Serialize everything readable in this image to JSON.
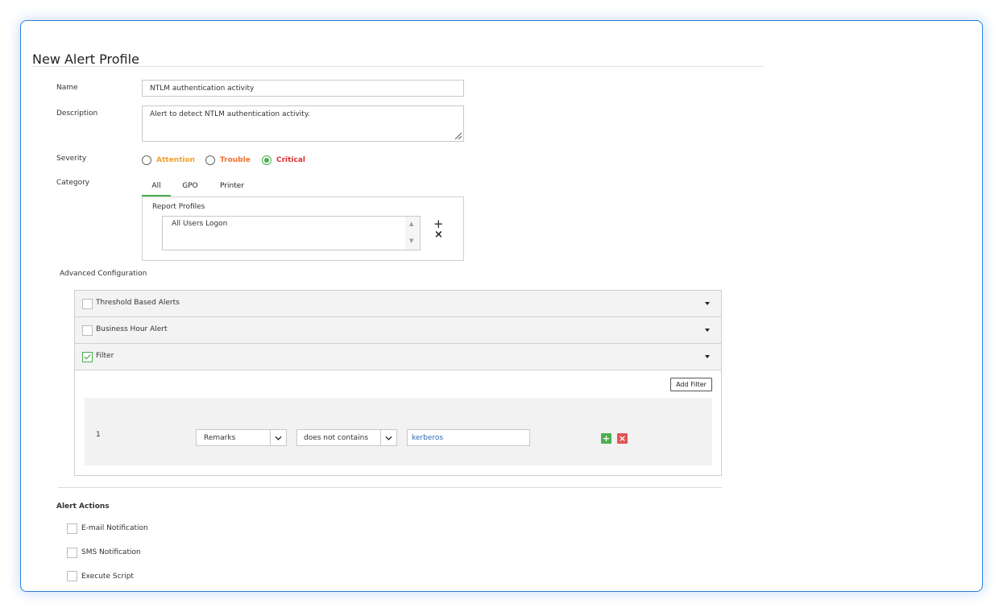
{
  "page": {
    "title": "New Alert Profile"
  },
  "form": {
    "name_label": "Name",
    "name_value": "NTLM authentication activity",
    "description_label": "Description",
    "description_value": "Alert to detect NTLM authentication activity.",
    "severity_label": "Severity",
    "severity_options": [
      {
        "label": "Attention",
        "color": "#f0a030",
        "selected": false
      },
      {
        "label": "Trouble",
        "color": "#f07030",
        "selected": false
      },
      {
        "label": "Critical",
        "color": "#e03030",
        "selected": true
      }
    ],
    "category_label": "Category",
    "category_tabs": [
      "All",
      "GPO",
      "Printer"
    ],
    "active_tab": "All",
    "report_profiles_label": "Report Profiles",
    "report_profiles": [
      "All Users Logon"
    ],
    "add_glyph": "+",
    "remove_glyph": "×"
  },
  "advanced": {
    "label": "Advanced Configuration",
    "panels": [
      {
        "label": "Threshold Based Alerts",
        "checked": false
      },
      {
        "label": "Business Hour Alert",
        "checked": false
      },
      {
        "label": "Filter",
        "checked": true
      }
    ],
    "add_filter_label": "Add Filter",
    "filter_row": {
      "index": "1",
      "field": "Remarks",
      "operator": "does not contains",
      "value": "kerberos"
    }
  },
  "alert_actions": {
    "label": "Alert Actions",
    "items": [
      "E-mail Notification",
      "SMS Notification",
      "Execute Script"
    ]
  },
  "colors": {
    "accent": "#4caf50",
    "frame": "#2f7fd6",
    "delete": "#e05555",
    "link": "#2a6db0"
  }
}
